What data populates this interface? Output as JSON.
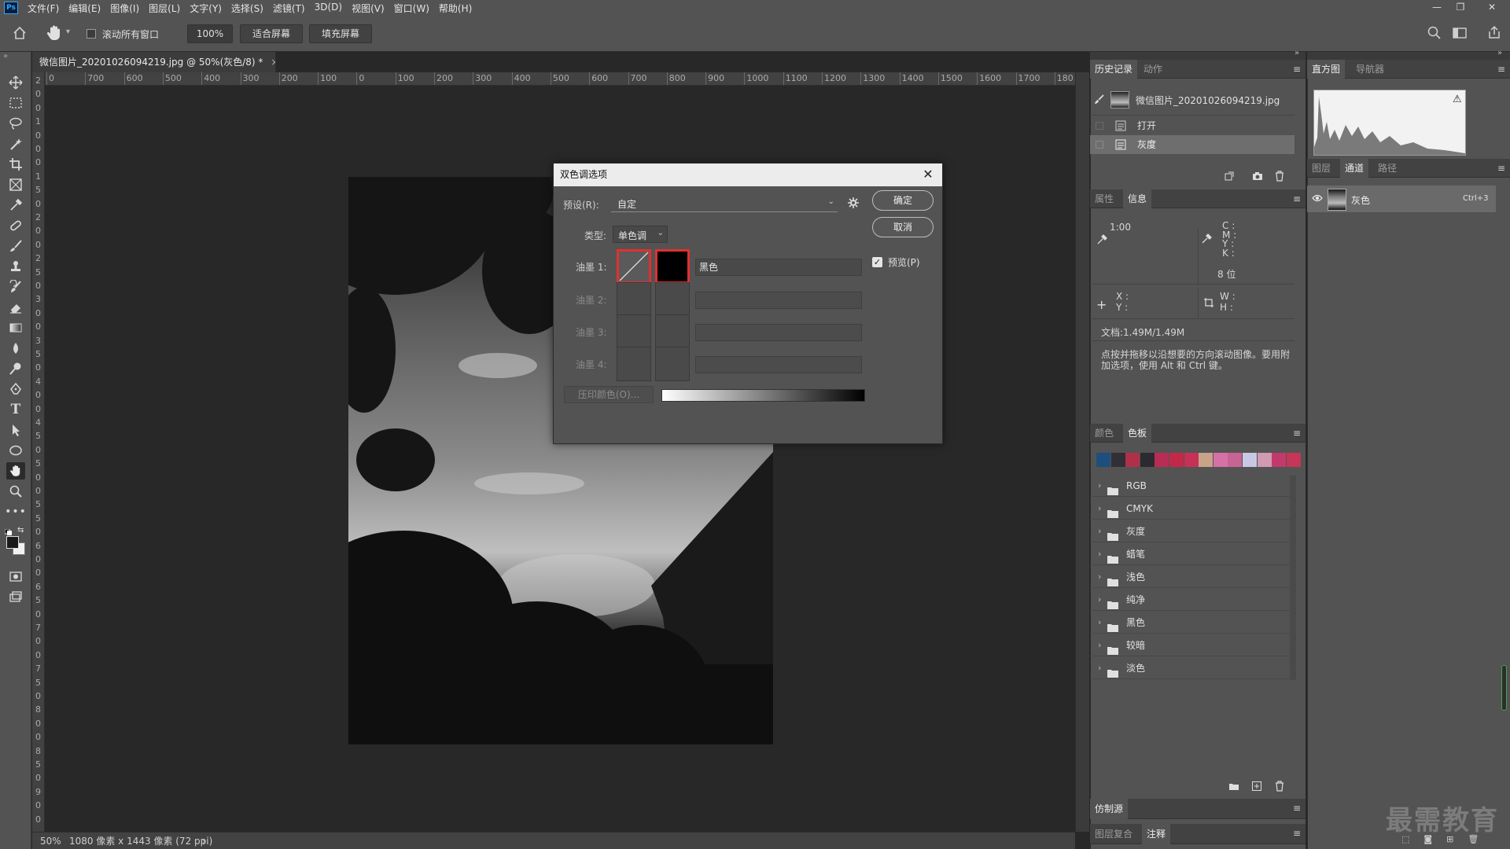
{
  "app": {
    "logo": "Ps"
  },
  "menu": [
    "文件(F)",
    "编辑(E)",
    "图像(I)",
    "图层(L)",
    "文字(Y)",
    "选择(S)",
    "滤镜(T)",
    "3D(D)",
    "视图(V)",
    "窗口(W)",
    "帮助(H)"
  ],
  "options": {
    "scroll_all_label": "滚动所有窗口",
    "zoom_value": "100%",
    "fit_screen": "适合屏幕",
    "fill_screen": "填充屏幕"
  },
  "document": {
    "tab_title": "微信图片_20201026094219.jpg @ 50%(灰色/8) *",
    "tab_close": "×",
    "ruler_h": [
      "0",
      "700",
      "600",
      "500",
      "400",
      "300",
      "200",
      "100",
      "0",
      "100",
      "200",
      "300",
      "400",
      "500",
      "600",
      "700",
      "800",
      "900",
      "1000",
      "1100",
      "1200",
      "1300",
      "1400",
      "1500",
      "1600",
      "1700",
      "180"
    ],
    "ruler_v": [
      "2",
      "0",
      "0",
      "1",
      "0",
      "0",
      "0",
      "1",
      "5",
      "0",
      "2",
      "0",
      "0",
      "2",
      "5",
      "0",
      "3",
      "0",
      "0",
      "3",
      "5",
      "0",
      "4",
      "0",
      "0",
      "4",
      "5",
      "0",
      "5",
      "0",
      "0",
      "5",
      "5",
      "0",
      "6",
      "0",
      "0",
      "6",
      "5",
      "0",
      "7",
      "0",
      "0",
      "7",
      "5",
      "0",
      "8",
      "0",
      "0",
      "8",
      "5",
      "0",
      "9",
      "0",
      "0"
    ]
  },
  "status": {
    "zoom": "50%",
    "doc_info": "1080 像素 x 1443 像素 (72 ppi)",
    "arrow": "›"
  },
  "dialog": {
    "title": "双色调选项",
    "close": "✕",
    "preset_label": "预设(R):",
    "preset_value": "自定",
    "type_label": "类型:",
    "type_value": "单色调",
    "ok": "确定",
    "cancel": "取消",
    "preview_label": "预览(P)",
    "preview_checked": true,
    "ink_labels": [
      "油墨 1:",
      "油墨 2:",
      "油墨 3:",
      "油墨 4:"
    ],
    "ink1_name": "黑色",
    "overprint": "压印颜色(O)..."
  },
  "history_panel": {
    "tabs": [
      "历史记录",
      "动作"
    ],
    "snapshot": "微信图片_20201026094219.jpg",
    "items": [
      "打开",
      "灰度"
    ]
  },
  "info_panel": {
    "tabs": [
      "属性",
      "信息"
    ],
    "ratio": "1:00",
    "cmyk_labels": [
      "C :",
      "M :",
      "Y :",
      "K :"
    ],
    "bit": "8 位",
    "xy_labels": [
      "X :",
      "Y :"
    ],
    "wh_labels": [
      "W :",
      "H :"
    ],
    "doc_size": "文档:1.49M/1.49M",
    "hint": "点按并拖移以沿想要的方向滚动图像。要用附加选项，使用 Alt 和 Ctrl 键。"
  },
  "swatches_panel": {
    "tabs": [
      "颜色",
      "色板"
    ],
    "colors": [
      "#1d4f7e",
      "#2f2f35",
      "#b0304a",
      "#2a2a30",
      "#b82d55",
      "#c42848",
      "#c73155",
      "#c8a38a",
      "#d870a8",
      "#c86494",
      "#c8c8e6",
      "#d09ab2",
      "#c23a6c",
      "#c63658"
    ],
    "folders": [
      "RGB",
      "CMYK",
      "灰度",
      "蜡笔",
      "浅色",
      "纯净",
      "黑色",
      "较暗",
      "淡色"
    ]
  },
  "bottom_panels": {
    "clone_source": "仿制源",
    "tabs": [
      "图层复合",
      "注释"
    ]
  },
  "histogram_panel": {
    "tabs": [
      "直方图",
      "导航器"
    ],
    "warning": "⚠"
  },
  "channels_panel": {
    "tabs": [
      "图层",
      "通道",
      "路径"
    ],
    "channel_name": "灰色",
    "shortcut": "Ctrl+3"
  },
  "watermark": "最需教育",
  "colors": {
    "ui_bg": "#535353",
    "canvas_bg": "#282828",
    "accent_red": "#e03030"
  }
}
